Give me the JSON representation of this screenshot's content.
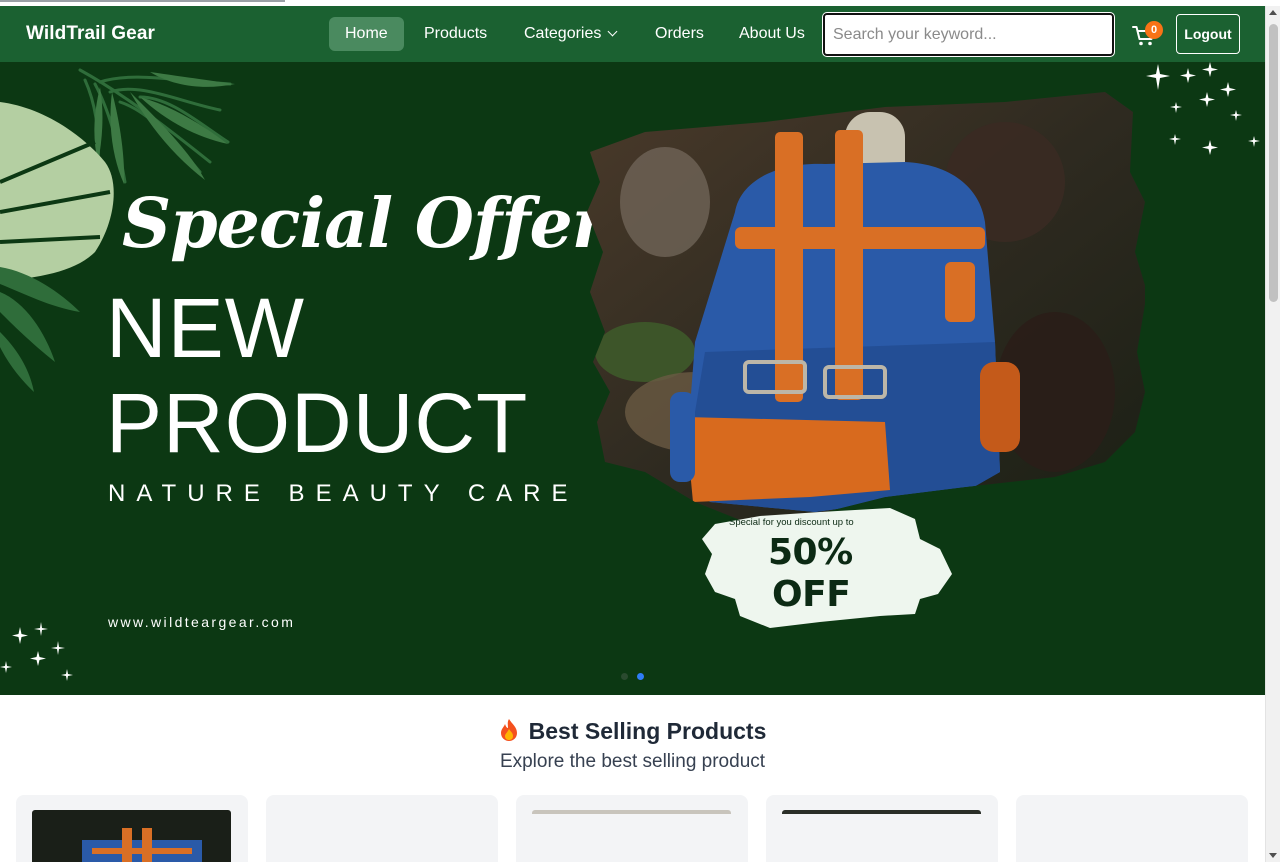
{
  "navbar": {
    "brand": "WildTrail Gear",
    "items": [
      {
        "label": "Home",
        "active": true
      },
      {
        "label": "Products"
      },
      {
        "label": "Categories"
      },
      {
        "label": "Orders"
      },
      {
        "label": "About Us"
      }
    ],
    "search_placeholder": "Search your keyword...",
    "search_value": "",
    "cart_count": "0",
    "logout_label": "Logout"
  },
  "hero": {
    "script_title": "Special Offer",
    "headline_1": "NEW",
    "headline_2": "PRODUCT",
    "tagline": "NATURE BEAUTY CARE",
    "website": "www.wildteargear.com",
    "discount_small": "Special for you discount up to",
    "discount_big": "50%",
    "discount_off": "OFF",
    "slides": 2,
    "active_slide": 2
  },
  "section": {
    "title": "Best Selling Products",
    "subtitle": "Explore the best selling product"
  },
  "colors": {
    "nav_bg": "#1b6131",
    "hero_bg": "#0c3813",
    "accent": "#f97316",
    "active_dot": "#2f7df6"
  },
  "icons": [
    "cart-icon",
    "chevron-down-icon",
    "fire-icon",
    "sparkle-icon",
    "leaf-icon"
  ]
}
